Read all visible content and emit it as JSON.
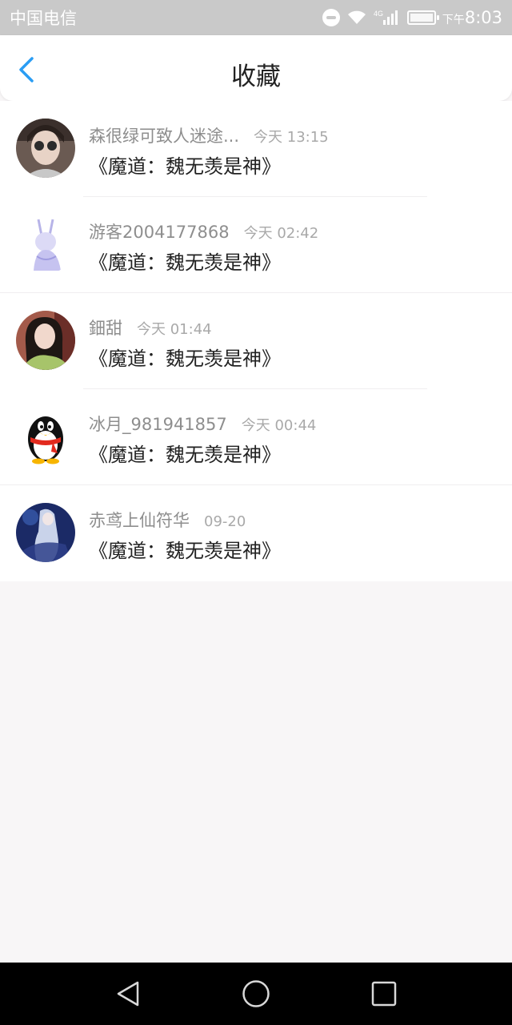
{
  "status_bar": {
    "carrier": "中国电信",
    "network": "4G",
    "ampm": "下午",
    "time": "8:03"
  },
  "header": {
    "title": "收藏",
    "back_icon": "chevron-left-icon",
    "accent_color": "#2a9df4"
  },
  "favorites": [
    {
      "username": "森很绿可致人迷途...",
      "time": "今天 13:15",
      "title": "《魔道：魏无羡是神》",
      "avatar": "photo-girl-sunglasses"
    },
    {
      "username": "游客2004177868",
      "time": "今天 02:42",
      "title": "《魔道：魏无羡是神》",
      "avatar": "anime-bunny-sketch"
    },
    {
      "username": "鈿甜",
      "time": "今天 01:44",
      "title": "《魔道：魏无羡是神》",
      "avatar": "photo-girl"
    },
    {
      "username": "冰月_981941857",
      "time": "今天 00:44",
      "title": "《魔道：魏无羡是神》",
      "avatar": "qq-penguin"
    },
    {
      "username": "赤鸢上仙符华",
      "time": "09-20",
      "title": "《魔道：魏无羡是神》",
      "avatar": "anime-character-blue"
    }
  ],
  "nav_bar": {
    "back_icon": "triangle-back-icon",
    "home_icon": "circle-home-icon",
    "recent_icon": "square-recent-icon"
  }
}
